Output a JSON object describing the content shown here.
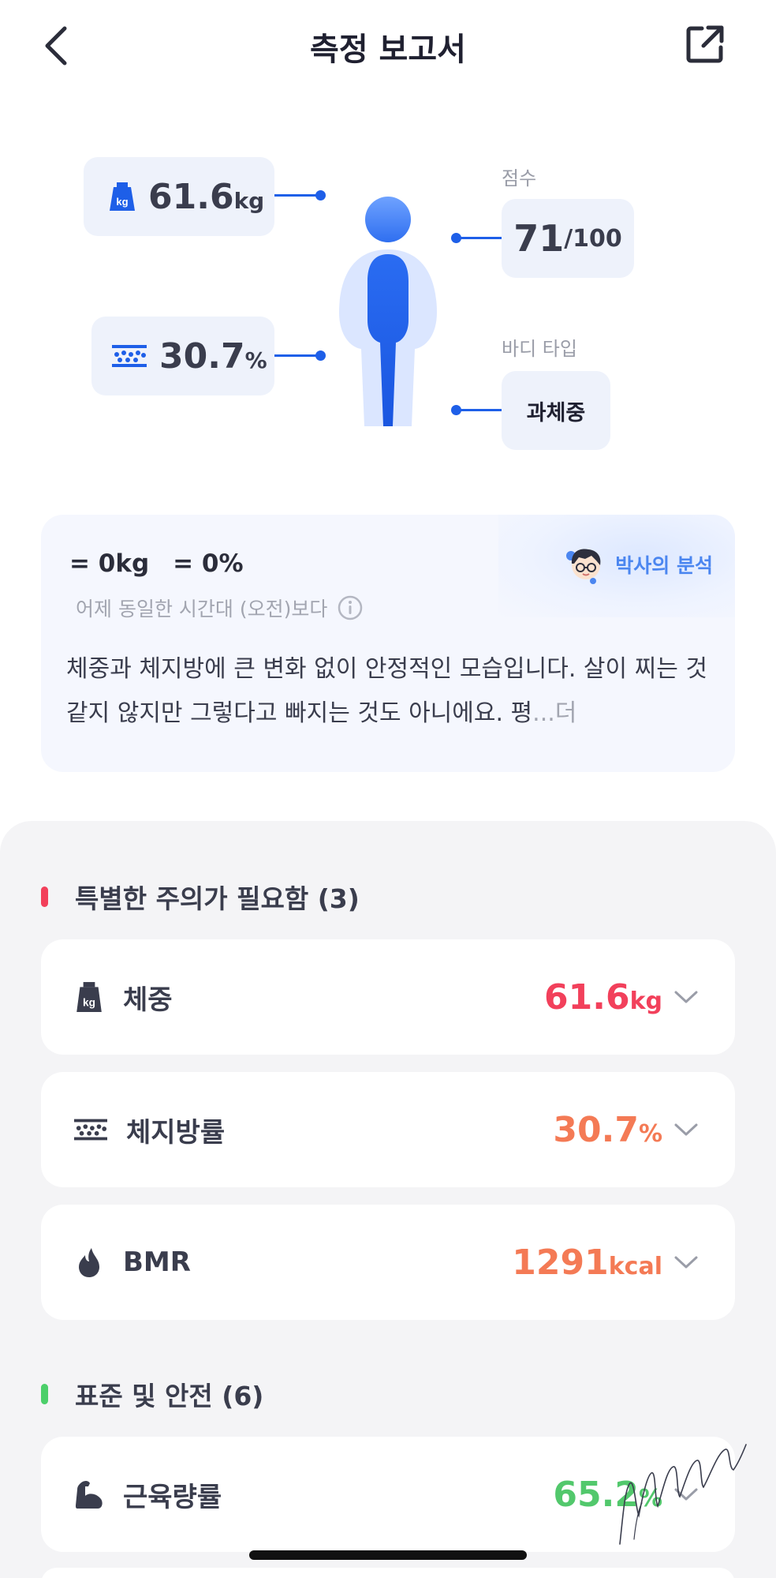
{
  "header": {
    "title": "측정 보고서",
    "back_icon": "chevron-left-icon",
    "share_icon": "share-external-icon"
  },
  "summary": {
    "weight": {
      "value": "61.6",
      "unit": "kg",
      "icon": "weight-scale-icon",
      "icon_text": "kg"
    },
    "body_fat": {
      "value": "30.7",
      "unit": "%",
      "icon": "body-fat-icon"
    },
    "score": {
      "label": "점수",
      "value": "71",
      "max": "/100"
    },
    "body_type": {
      "label": "바디 타입",
      "value": "과체중"
    }
  },
  "analysis": {
    "doctor_label": "박사의 분석",
    "weight_change": "= 0kg",
    "fat_change": "= 0%",
    "compare_text": "어제 동일한 시간대 (오전)보다",
    "body_text": "체중과 체지방에 큰 변화 없이 안정적인 모습입니다. 살이 찌는 것 같지 않지만 그렇다고 빠지는 것도 아니에요. 평",
    "more_text": "...더"
  },
  "groups": [
    {
      "title": "특별한 주의가 필요함 (3)",
      "color": "#f2405b",
      "items": [
        {
          "label": "체중",
          "value": "61.6",
          "unit": "kg",
          "color": "#f2405b",
          "icon": "weight-scale-icon"
        },
        {
          "label": "체지방률",
          "value": "30.7",
          "unit": "%",
          "color": "#f47a55",
          "icon": "body-fat-icon"
        },
        {
          "label": "BMR",
          "value": "1291",
          "unit": "kcal",
          "color": "#f47a55",
          "icon": "flame-icon"
        }
      ]
    },
    {
      "title": "표준 및 안전 (6)",
      "color": "#4ccf6a",
      "items": [
        {
          "label": "근육량률",
          "value": "65.2",
          "unit": "%",
          "color": "#52c86c",
          "icon": "muscle-icon"
        }
      ]
    }
  ],
  "colors": {
    "accent_blue": "#1e5fe8",
    "pill_bg": "#eef2fb",
    "section_bg": "#f4f4f6"
  }
}
